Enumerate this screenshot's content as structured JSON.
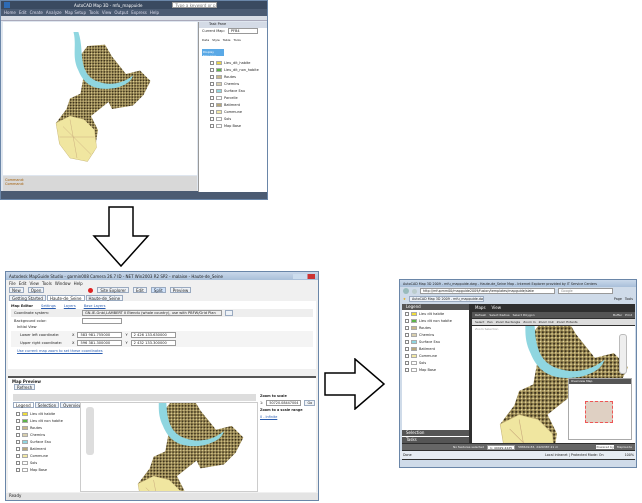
{
  "autocad": {
    "title": "AutoCAD Map 3D - mfu_mappuide",
    "search_placeholder": "Type a keyword or phrase",
    "menus": [
      "Home",
      "Edit",
      "Create",
      "Analyze",
      "Map Setup",
      "Tools",
      "View",
      "Output",
      "Express",
      "Help"
    ],
    "task_pane_title": "Task Pane",
    "current_map_label": "Current Map:",
    "current_map": "PFB4",
    "pane_buttons": [
      "Data",
      "Style",
      "Table",
      "Tools"
    ],
    "display_manager": "Display Manager",
    "layers": [
      {
        "label": "Lieu_dit_habite",
        "color": "#e8d44a"
      },
      {
        "label": "Lieu_dit_non_habite",
        "color": "#5cb548"
      },
      {
        "label": "Routes",
        "color": "#c9b88a"
      },
      {
        "label": "Chemins",
        "color": "#d9cfae"
      },
      {
        "label": "Surface Eau",
        "color": "#8fd6e0"
      },
      {
        "label": "Parcelle",
        "color": "#ffffff"
      },
      {
        "label": "Batiment",
        "color": "#b7a77a"
      },
      {
        "label": "Commune",
        "color": "#f3e9a5"
      },
      {
        "label": "Sols",
        "color": "#ffffff"
      },
      {
        "label": "Map Base",
        "color": "#ffffff"
      }
    ],
    "command_lines": [
      "Command:",
      "Command:"
    ]
  },
  "studio": {
    "title": "Autodesk MapGuide Studio - garmin008 Camera 26.7 ID - NET Win2003 R2 SP2 - malaise - Haute-de_Seine",
    "menus": [
      "File",
      "Edit",
      "View",
      "Tools",
      "Window",
      "Help"
    ],
    "toolbar": [
      "New",
      "Open",
      "Site Explorer",
      "Edit",
      "Split",
      "Preview"
    ],
    "tabs": [
      "Getting Started",
      "Haute-de_Seine",
      "Haute-de_Seine"
    ],
    "editor_title": "Map Editor",
    "editor_links": [
      "Settings",
      "Layers",
      "Base Layers"
    ],
    "coord_label": "Coordinate system:",
    "coord_value": "GN-IE-Gnbl,LAMBERT II Etendu (whole country), use with PBFW/Grid Plan",
    "bg_label": "Background color:",
    "initial_view": "Initial View",
    "lower_left_label": "Lower left coordinate:",
    "lower_left_x": "583 981.755000",
    "lower_left_y": "2 426 133.630000",
    "upper_right_label": "Upper right coordinate:",
    "upper_right_x": "596 381.300000",
    "upper_right_y": "2 432 133.300000",
    "use_current_link": "Use current map zoom to set these coordinates",
    "preview_title": "Map Preview",
    "refresh": "Refresh",
    "preview_tabs": [
      "Legend",
      "Selection",
      "Overview"
    ],
    "legend": [
      {
        "label": "Lieu dit habite",
        "color": "#f1de3a"
      },
      {
        "label": "Lieu dit non habite",
        "color": "#5cb548"
      },
      {
        "label": "Routes",
        "color": "#c9b88a"
      },
      {
        "label": "Chemins",
        "color": "#d9cfae"
      },
      {
        "label": "Surface Eau",
        "color": "#8fd6e0"
      },
      {
        "label": "Batiment",
        "color": "#b7a77a"
      },
      {
        "label": "Commune",
        "color": "#f3e9a5"
      },
      {
        "label": "Sols",
        "color": "#ffffff"
      },
      {
        "label": "Map Base",
        "color": "#ffffff"
      }
    ],
    "zoom_scale_label": "Zoom to scale",
    "zoom_scale_value": "50720.08447004",
    "go": "Go",
    "zoom_range_label": "Zoom to a scale range",
    "zoom_range_link": "0 - Infinite",
    "status": "Ready"
  },
  "browser": {
    "title": "AutoCAD Map 3D 2009 - mfu_mappuide.dwg - Haute-de_Seine Map - Internet Explorer provided by IT Service Centers",
    "url": "http://mfupmm00/mapguide2009/fusion/templates/mapguide/slate",
    "search_placeholder": "Google",
    "tab": "AutoCAD Map 3D 2009 - mfu_mappuide.dwg - H...",
    "page_menu": "Page",
    "tools_menu": "Tools",
    "legend_title": "Legend",
    "menus": [
      "Maps",
      "View"
    ],
    "tools": [
      "Refresh",
      "Select Radius",
      "Select Polygon",
      "Buffer",
      "Print"
    ],
    "tools2": [
      "Select",
      "Pan",
      "Zoom Rectangle",
      "Zoom In",
      "Zoom Out",
      "Zoom Extents"
    ],
    "zoom_selection": "Zoom Selection",
    "legend": [
      {
        "label": "Lieu dit habite",
        "color": "#f1de3a"
      },
      {
        "label": "Lieu dit non habite",
        "color": "#5cb548"
      },
      {
        "label": "Routes",
        "color": "#c9b88a"
      },
      {
        "label": "Chemins",
        "color": "#d9cfae"
      },
      {
        "label": "Surface Eau",
        "color": "#8fd6e0"
      },
      {
        "label": "Batiment",
        "color": "#b7a77a"
      },
      {
        "label": "Commune",
        "color": "#f3e9a5"
      },
      {
        "label": "Sols",
        "color": "#ffffff"
      },
      {
        "label": "Map Base",
        "color": "#ffffff"
      }
    ],
    "panels": [
      "Selection",
      "Tasks"
    ],
    "overview_title": "Overview Map",
    "no_features": "No features selected",
    "scale": "1: 40429.4225",
    "coords": "588649.83, 2429387.21 m",
    "powered_by": "Powered by",
    "mapguide": "MapGuide",
    "status": "Done",
    "zone": "Local intranet | Protected Mode: On",
    "zoom": "100%"
  }
}
